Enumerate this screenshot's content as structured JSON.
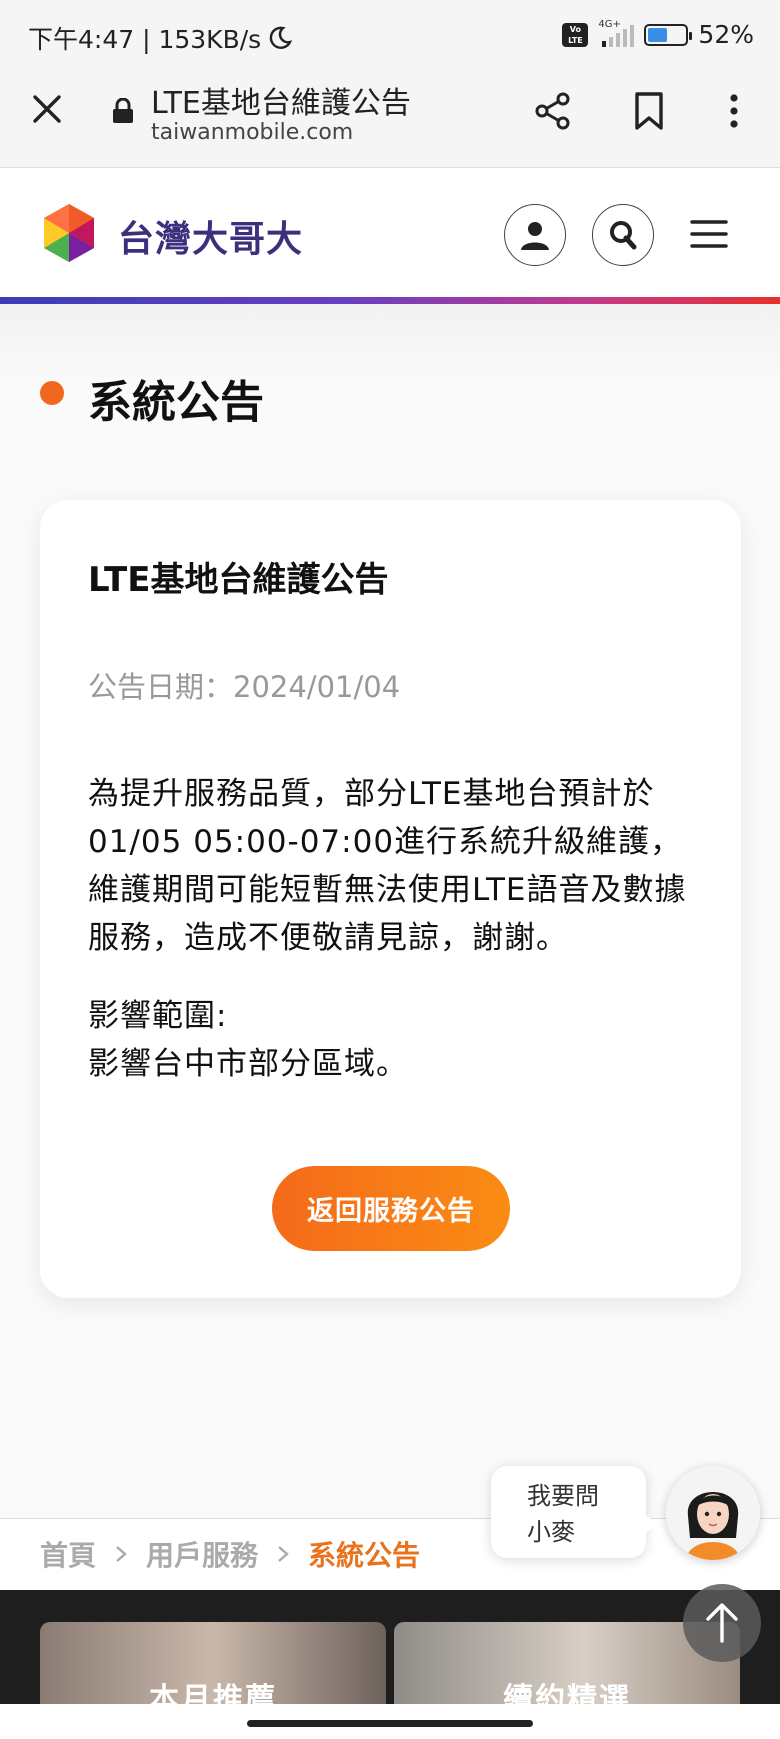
{
  "status_bar": {
    "time_speed": "下午4:47 | 153KB/s",
    "network_label": "4G+",
    "volte_label": "Vo LTE",
    "battery": "52%",
    "battery_level": 0.52
  },
  "browser": {
    "page_title": "LTE基地台維護公告",
    "url": "taiwanmobile.com",
    "icons": [
      "close-icon",
      "lock-icon",
      "share-icon",
      "bookmark-icon",
      "more-vert-icon"
    ]
  },
  "site_header": {
    "brand": "台灣大哥大",
    "icons": [
      "user-icon",
      "search-icon",
      "menu-icon"
    ]
  },
  "section": {
    "title": "系統公告"
  },
  "announcement": {
    "title": "LTE基地台維護公告",
    "date": "公告日期：2024/01/04",
    "body": "為提升服務品質，部分LTE基地台預計於01/05 05:00-07:00進行系統升級維護，維護期間可能短暫無法使用LTE語音及數據服務，造成不便敬請見諒，謝謝。",
    "range_label": "影響範圍:",
    "range_text": "影響台中市部分區域。",
    "back_button": "返回服務公告"
  },
  "breadcrumb": {
    "items": [
      "首頁",
      "用戶服務",
      "系統公告"
    ]
  },
  "chat": {
    "line1": "我要問",
    "line2": "小麥"
  },
  "footer": {
    "promos": [
      "本月推薦",
      "續約精選"
    ]
  },
  "colors": {
    "accent_orange": "#f2671f",
    "brand_purple": "#3b2f7e",
    "gradient": [
      "#3a3db7",
      "#e8302a"
    ]
  }
}
